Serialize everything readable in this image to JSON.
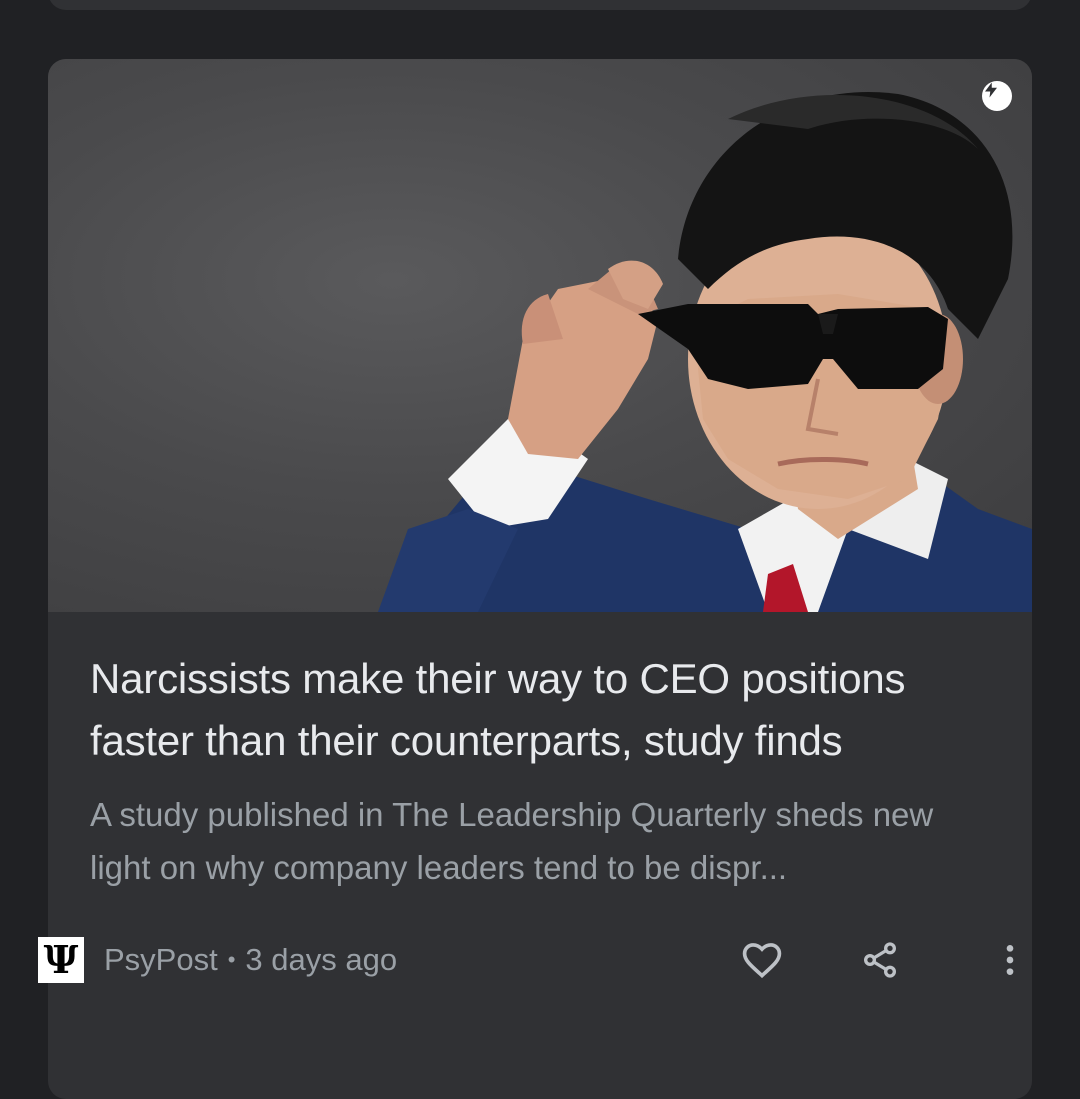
{
  "article": {
    "headline": "Narcissists make their way to CEO positions faster than their counterparts, study finds",
    "snippet": "A study published in The Leadership Quarterly sheds new light on why company leaders tend to be dispr...",
    "source": {
      "name": "PsyPost",
      "logo_glyph": "Ψ",
      "separator": "•",
      "age": "3 days ago"
    },
    "image": {
      "subject": "man-in-sunglasses-photo"
    },
    "amp_icon": "lightning-bolt-icon"
  },
  "actions": {
    "like_icon": "heart-icon",
    "share_icon": "share-icon",
    "more_icon": "more-vert-icon"
  },
  "colors": {
    "background": "#202124",
    "card": "#303134",
    "headline": "#e8eaed",
    "secondary": "#9aa0a6"
  }
}
